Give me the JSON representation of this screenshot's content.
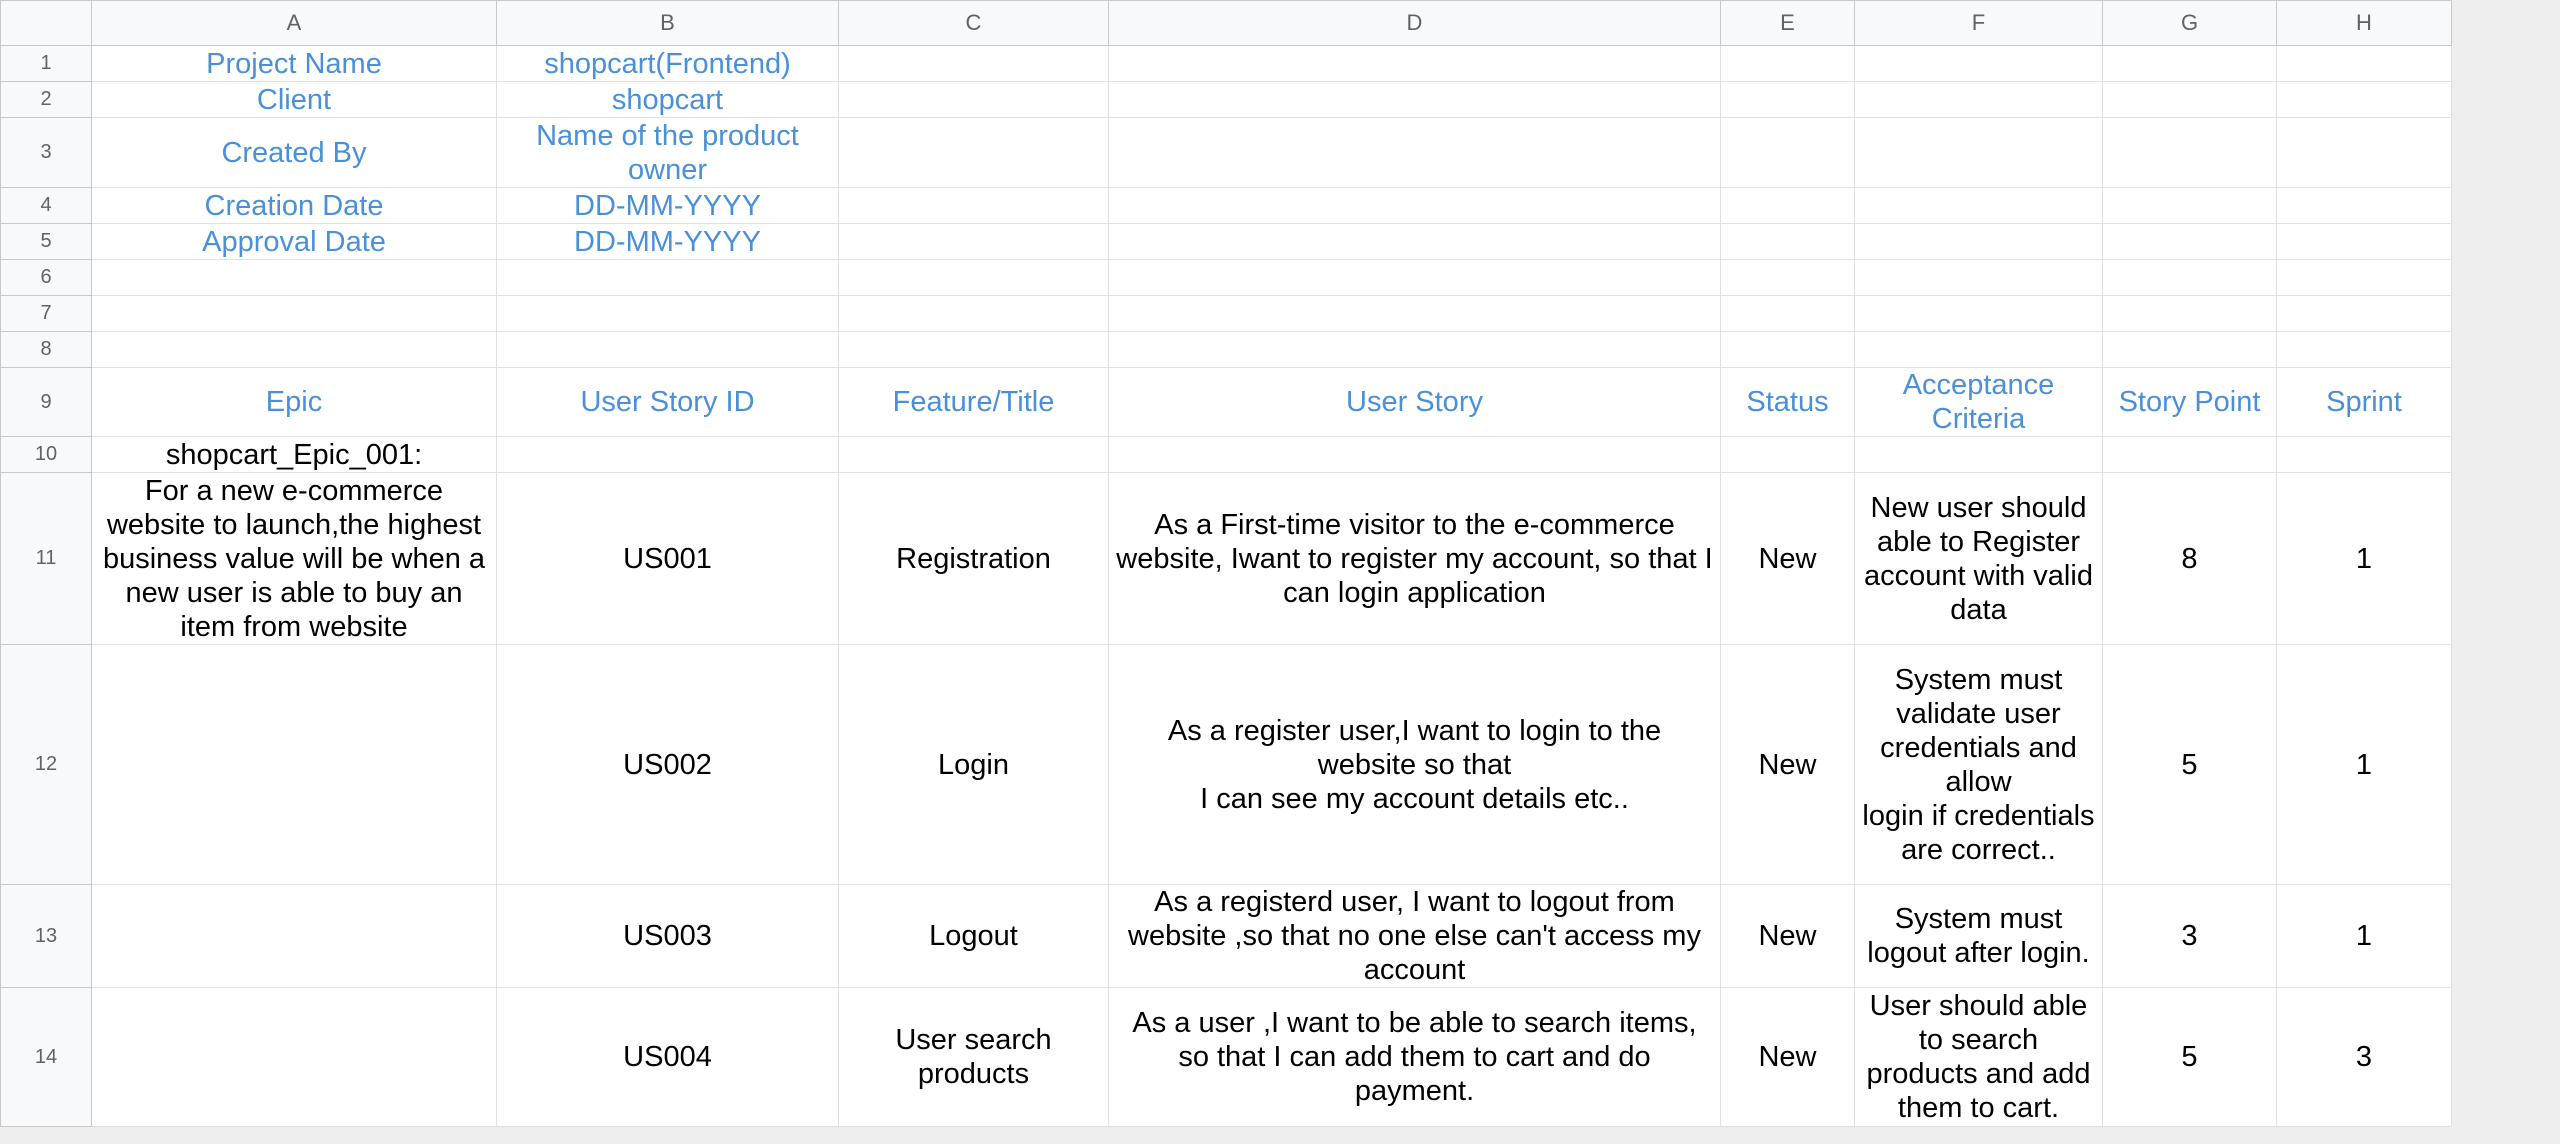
{
  "columns": [
    "A",
    "B",
    "C",
    "D",
    "E",
    "F",
    "G",
    "H"
  ],
  "meta": {
    "project_name_label": "Project Name",
    "project_name_value": "shopcart(Frontend)",
    "client_label": "Client",
    "client_value": "shopcart",
    "created_by_label": "Created By",
    "created_by_value": "Name of the product owner",
    "creation_date_label": "Creation Date",
    "creation_date_value": "DD-MM-YYYY",
    "approval_date_label": "Approval Date",
    "approval_date_value": "DD-MM-YYYY"
  },
  "headers": {
    "epic": "Epic",
    "user_story_id": "User Story ID",
    "feature_title": "Feature/Title",
    "user_story": "User Story",
    "status": "Status",
    "acceptance_criteria": "Acceptance Criteria",
    "story_point": "Story Point",
    "sprint": "Sprint"
  },
  "epic": {
    "id": "shopcart_Epic_001:",
    "description": "For a new e-commerce website to launch,the highest business value will be when a new user is able to buy an item from website"
  },
  "stories": [
    {
      "row": "11",
      "id": "US001",
      "title": "Registration",
      "story": "As a First-time visitor to the e-commerce website, Iwant to register my account, so that I can login application",
      "status": "New",
      "acceptance": "New user should able to Register account with valid data",
      "points": "8",
      "sprint": "1"
    },
    {
      "row": "12",
      "id": "US002",
      "title": "Login",
      "story": "As a register user,I want to login to the website so that\nI can see my account details etc..",
      "status": "New",
      "acceptance": "System must validate user credentials and allow\nlogin if credentials are correct..",
      "points": "5",
      "sprint": "1"
    },
    {
      "row": "13",
      "id": "US003",
      "title": "Logout",
      "story": "As a registerd user, I want to logout from website ,so that no one else can't access my account",
      "status": "New",
      "acceptance": "System must logout after login.",
      "points": "3",
      "sprint": "1"
    },
    {
      "row": "14",
      "id": "US004",
      "title": "User search products",
      "story": "As a user ,I want to be able to search items, so that I can add them to cart and do payment.",
      "status": "New",
      "acceptance": "User should able to search products and add them to cart.",
      "points": "5",
      "sprint": "3"
    }
  ],
  "row_numbers": [
    "1",
    "2",
    "3",
    "4",
    "5",
    "6",
    "7",
    "8",
    "9",
    "10",
    "11",
    "12",
    "13",
    "14"
  ],
  "colors": {
    "header_text": "#4a90d9",
    "grid": "#e1e1e1",
    "row_header_bg": "#f8f9fa"
  }
}
